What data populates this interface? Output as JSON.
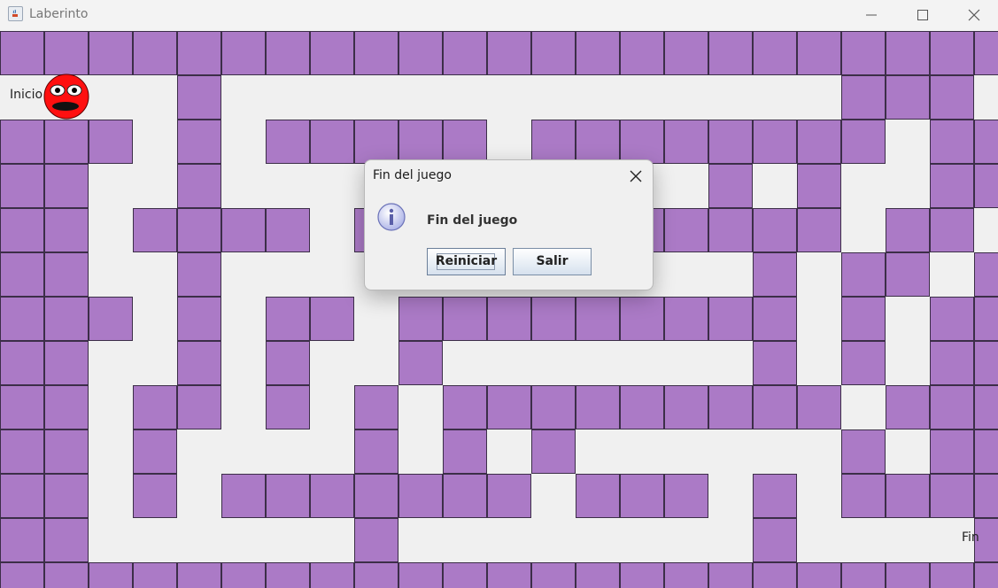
{
  "window": {
    "title": "Laberinto"
  },
  "maze": {
    "start_label": "Inicio",
    "end_label": "Fin",
    "wall_color": "#ab7ac6",
    "path_color": "#f0f0f0",
    "player": "red-smiley"
  },
  "dialog": {
    "title": "Fin del juego",
    "message": "Fin del juego",
    "icon": "info-icon",
    "buttons": {
      "restart": "Reiniciar",
      "exit": "Salir"
    }
  }
}
